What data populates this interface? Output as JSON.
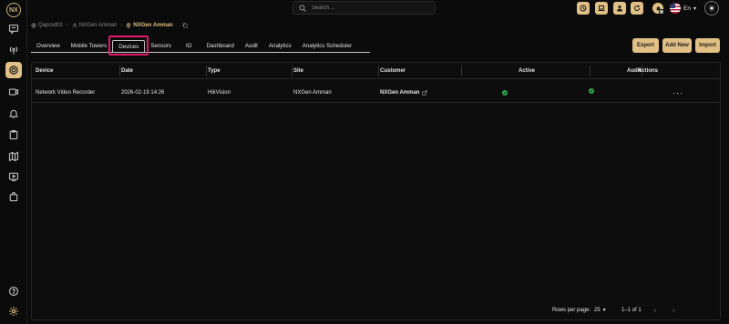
{
  "brand": {
    "logo_text": "NX"
  },
  "search": {
    "placeholder": "Search ..."
  },
  "header": {
    "language": "En"
  },
  "breadcrumb": {
    "items": [
      "Qaprod02",
      "NXGen Amman",
      "NXGen Amman"
    ]
  },
  "tabs": [
    {
      "label": "Overview"
    },
    {
      "label": "Mobile Towers"
    },
    {
      "label": "Devices"
    },
    {
      "label": "Sensors"
    },
    {
      "label": "IO"
    },
    {
      "label": "Dashboard"
    },
    {
      "label": "Audit"
    },
    {
      "label": "Analytics"
    },
    {
      "label": "Analytics Scheduler"
    }
  ],
  "active_tab": "Devices",
  "actions": {
    "export": "Export",
    "add_new": "Add New",
    "import": "Import"
  },
  "table": {
    "columns": [
      "Device",
      "Date",
      "Type",
      "Site",
      "Customer",
      "Active",
      "Audio",
      "Actions"
    ],
    "rows": [
      {
        "device": "Network Video Recorder",
        "date": "2026-02-19 14:26",
        "type": "HikVision",
        "site": "NXGen Amman",
        "customer": "NXGen Amman",
        "active": true,
        "audio": true,
        "actions": "···"
      }
    ]
  },
  "pagination": {
    "rows_per_page_label": "Rows per page:",
    "rows_per_page": "25",
    "range": "1–1 of 1"
  },
  "colors": {
    "accent": "#e0c084",
    "highlight": "#e0196c",
    "success": "#2fa84f",
    "background": "#0b0b0b"
  }
}
